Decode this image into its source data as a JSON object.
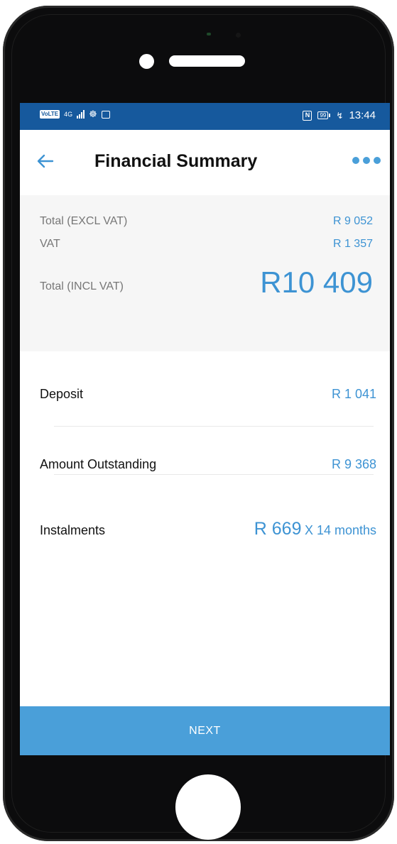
{
  "status_bar": {
    "network_chip": "VoLTE",
    "signal_label": "4G",
    "battery_level": "99",
    "time": "13:44",
    "icons": [
      "volte-icon",
      "signal-icon",
      "wifi-icon",
      "image-icon",
      "nfc-icon",
      "battery-icon",
      "charging-icon"
    ]
  },
  "header": {
    "title": "Financial Summary",
    "back_icon": "arrow-left-icon",
    "more_icon": "more-horizontal-icon"
  },
  "summary": {
    "total_excl_label": "Total (EXCL VAT)",
    "total_excl_value": "R 9 052",
    "vat_label": "VAT",
    "vat_value": "R 1 357",
    "total_incl_label": "Total (INCL VAT)",
    "total_incl_value": "R10 409"
  },
  "details": {
    "deposit_label": "Deposit",
    "deposit_value": "R 1 041",
    "outstanding_label": "Amount Outstanding",
    "outstanding_value": "R 9 368",
    "instalments_label": "Instalments",
    "instalments_amount": "R 669",
    "instalments_term": "X 14 months"
  },
  "footer": {
    "next_label": "NEXT"
  },
  "colors": {
    "status_bar": "#16599d",
    "accent": "#3d93d3",
    "button": "#4a9fd9",
    "summary_bg": "#f6f6f6"
  }
}
